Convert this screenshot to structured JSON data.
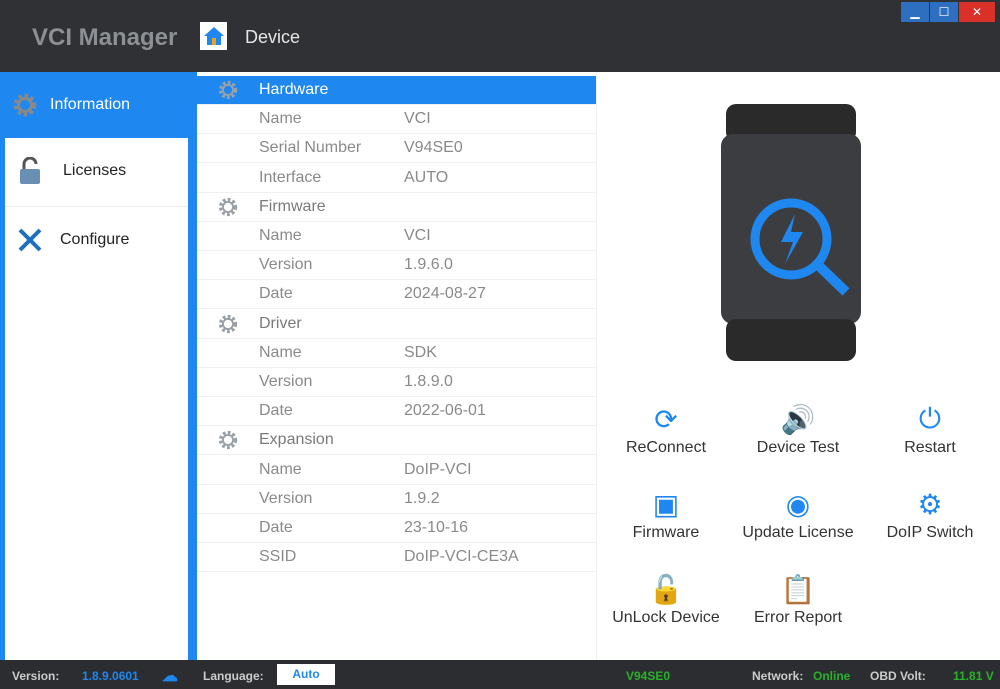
{
  "header": {
    "app_title": "VCI Manager",
    "page_title": "Device"
  },
  "sidebar": {
    "items": [
      {
        "label": "Information",
        "icon": "gear-icon"
      },
      {
        "label": "Licenses",
        "icon": "lock-icon"
      },
      {
        "label": "Configure",
        "icon": "tools-icon"
      }
    ]
  },
  "info": {
    "rows": [
      {
        "section": "Hardware"
      },
      {
        "k": "Name",
        "v": "VCI"
      },
      {
        "k": "Serial Number",
        "v": "V94SE0"
      },
      {
        "k": "Interface",
        "v": "AUTO"
      },
      {
        "section": "Firmware"
      },
      {
        "k": "Name",
        "v": "VCI"
      },
      {
        "k": "Version",
        "v": "1.9.6.0"
      },
      {
        "k": "Date",
        "v": "2024-08-27"
      },
      {
        "section": "Driver"
      },
      {
        "k": "Name",
        "v": "SDK"
      },
      {
        "k": "Version",
        "v": "1.8.9.0"
      },
      {
        "k": "Date",
        "v": "2022-06-01"
      },
      {
        "section": "Expansion"
      },
      {
        "k": "Name",
        "v": "DoIP-VCI"
      },
      {
        "k": "Version",
        "v": "1.9.2"
      },
      {
        "k": "Date",
        "v": "23-10-16"
      },
      {
        "k": "SSID",
        "v": "DoIP-VCI-CE3A"
      }
    ]
  },
  "actions": [
    {
      "label": "ReConnect"
    },
    {
      "label": "Device Test"
    },
    {
      "label": "Restart"
    },
    {
      "label": "Firmware"
    },
    {
      "label": "Update License"
    },
    {
      "label": "DoIP Switch"
    },
    {
      "label": "UnLock Device"
    },
    {
      "label": "Error Report"
    }
  ],
  "statusbar": {
    "version_label": "Version:",
    "version": "1.8.9.0601",
    "language_label": "Language:",
    "language": "Auto",
    "serial": "V94SE0",
    "network_label": "Network:",
    "network": "Online",
    "volt_label": "OBD Volt:",
    "volt": "11.81 V"
  },
  "colors": {
    "accent": "#1e88f0",
    "ok": "#2bb02b"
  }
}
